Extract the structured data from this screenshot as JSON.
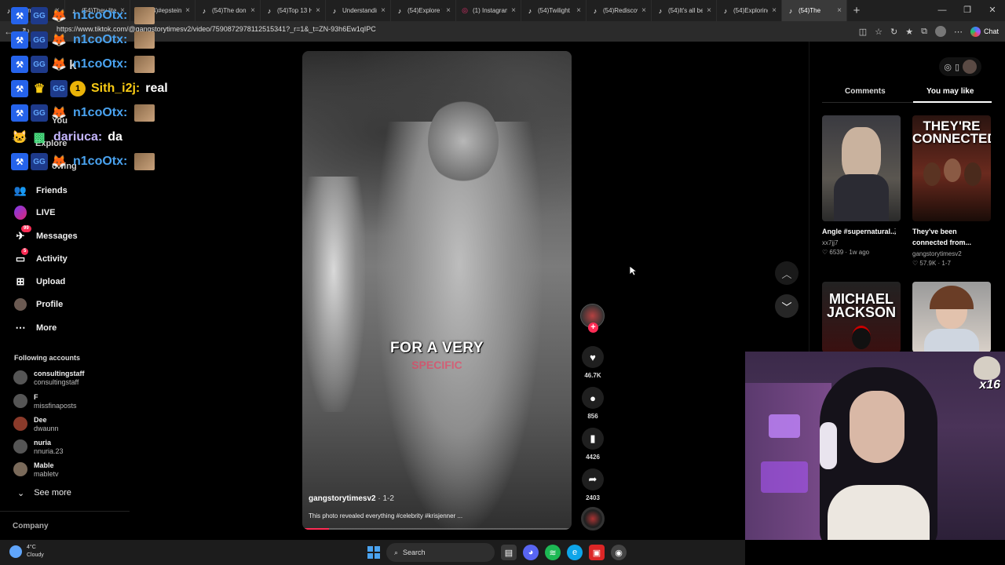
{
  "browser": {
    "tabs": [
      {
        "title": "Cosmi",
        "icon": "tiktok-icon"
      },
      {
        "title": "(54)They lite",
        "icon": "tiktok-icon"
      },
      {
        "title": "(54)#epstein",
        "icon": "tiktok-icon"
      },
      {
        "title": "(54)The donu",
        "icon": "tiktok-icon"
      },
      {
        "title": "(54)Top 13 H",
        "icon": "tiktok-icon"
      },
      {
        "title": "Understandin",
        "icon": "tiktok-icon"
      },
      {
        "title": "(54)Explore t",
        "icon": "tiktok-icon"
      },
      {
        "title": "(1) Instagram",
        "icon": "instagram-icon"
      },
      {
        "title": "(54)Twilight",
        "icon": "tiktok-icon"
      },
      {
        "title": "(54)Rediscov",
        "icon": "tiktok-icon"
      },
      {
        "title": "(54)It's all be",
        "icon": "tiktok-icon"
      },
      {
        "title": "(54)Exploring",
        "icon": "tiktok-icon"
      },
      {
        "title": "(54)The",
        "icon": "tiktok-icon"
      }
    ],
    "url": "https://www.tiktok.com/@gangstorytimesv2/video/7590872978112515341?_r=1&_t=ZN-93h6Ew1qIPC",
    "copilot_label": "Chat"
  },
  "sidebar": {
    "ghost_items": [
      "k",
      "You",
      "Explore",
      "owing"
    ],
    "items": [
      {
        "label": "Friends",
        "icon": "friends-icon"
      },
      {
        "label": "LIVE",
        "icon": "live-icon"
      },
      {
        "label": "Messages",
        "icon": "messages-icon",
        "badge": "99"
      },
      {
        "label": "Activity",
        "icon": "activity-icon",
        "badge": "5"
      },
      {
        "label": "Upload",
        "icon": "upload-icon"
      },
      {
        "label": "Profile",
        "icon": "profile-icon"
      },
      {
        "label": "More",
        "icon": "more-icon"
      }
    ],
    "following_title": "Following accounts",
    "accounts": [
      {
        "name": "consultingstaff",
        "handle": "consultingstaff"
      },
      {
        "name": "F",
        "handle": "missfinaposts"
      },
      {
        "name": "Dee",
        "handle": "dwaunn"
      },
      {
        "name": "nuria",
        "handle": "nnuria.23"
      },
      {
        "name": "Mable",
        "handle": "mabletv"
      }
    ],
    "see_more": "See more",
    "company": "Company"
  },
  "chat": [
    {
      "user": "n1coOtx:",
      "message": "",
      "user_color": "#4aa3f0"
    },
    {
      "user": "n1coOtx:",
      "message": "",
      "user_color": "#4aa3f0"
    },
    {
      "user": "n1coOtx:",
      "message": "",
      "user_color": "#4aa3f0"
    },
    {
      "user": "Sith_i2j:",
      "message": "real",
      "user_color": "#facc15",
      "badge_num": "1"
    },
    {
      "user": "n1coOtx:",
      "message": "",
      "user_color": "#4aa3f0"
    },
    {
      "user": "dariuca:",
      "message": "da",
      "user_color": "#c4b5fd"
    },
    {
      "user": "n1coOtx:",
      "message": "",
      "user_color": "#4aa3f0"
    }
  ],
  "video": {
    "caption_line1": "FOR A VERY",
    "caption_line2": "SPECIFIC",
    "author": "gangstorytimesv2",
    "date": " · 1-2",
    "description": "This photo revealed everything #celebrity #krisjenner ...",
    "progress": 0.1
  },
  "actions": {
    "likes": "46.7K",
    "comments": "856",
    "saves": "4426",
    "shares": "2403"
  },
  "right_panel": {
    "tabs": [
      "Comments",
      "You may like"
    ],
    "active_tab": "You may like",
    "cards": [
      {
        "title": "Angle #supernatural...",
        "author": "xx7jj7",
        "likes": "6539",
        "age": "1w ago",
        "thumb_text": ""
      },
      {
        "title": "They've been connected from...",
        "author": "gangstorytimesv2",
        "likes": "57.9K",
        "age": "1-7",
        "thumb_text": "THEY'RE CONNECTED"
      },
      {
        "title": "",
        "author": "",
        "likes": "",
        "age": "",
        "thumb_text": "MICHAEL JACKSON"
      },
      {
        "title": "",
        "author": "",
        "likes": "",
        "age": "",
        "thumb_text": ""
      }
    ]
  },
  "webcam": {
    "counter": "x16"
  },
  "taskbar": {
    "temperature": "4°C",
    "condition": "Cloudy",
    "search_label": "Search"
  }
}
